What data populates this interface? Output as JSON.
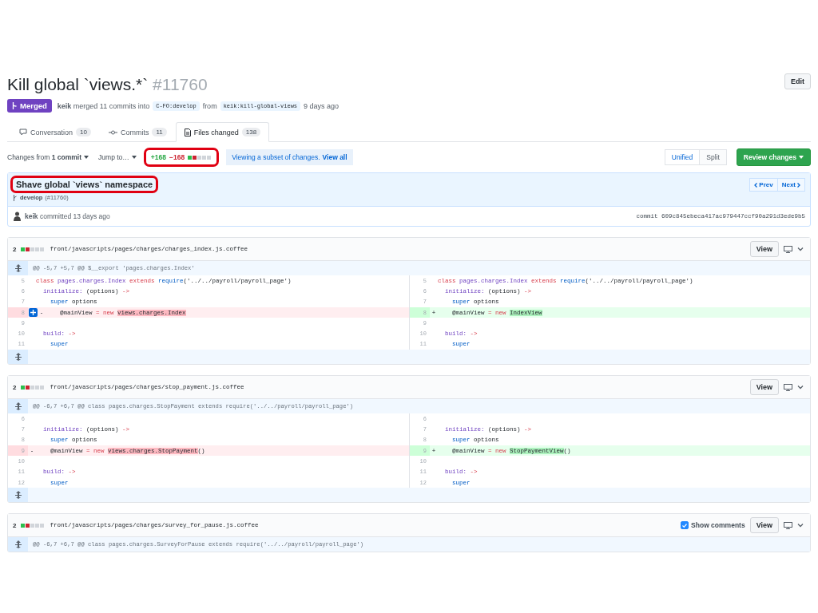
{
  "pull_request": {
    "title": "Kill global `views.*`",
    "number": "#11760",
    "edit_label": "Edit",
    "state": "Merged",
    "merge_text": "**keik** merged 11 commits into",
    "base_branch": "C-FO:develop",
    "from_label": "from",
    "head_branch": "keik:kill-global-views",
    "age": "9 days ago"
  },
  "tabs": [
    {
      "label": "Conversation",
      "count": "10",
      "selected": false
    },
    {
      "label": "Commits",
      "count": "11",
      "selected": false
    },
    {
      "label": "Files changed",
      "count": "138",
      "selected": true
    }
  ],
  "toolbar": {
    "changes_from": "Changes from **1 commit**",
    "jump_to": "Jump to…",
    "additions": "+168",
    "deletions": "−168",
    "stats_annotated": true,
    "notice": "Viewing a subset of changes.",
    "notice_link": "View all",
    "view_modes": [
      {
        "label": "Unified",
        "selected": true
      },
      {
        "label": "Split",
        "selected": false
      }
    ],
    "review_button": "Review changes"
  },
  "commit": {
    "title": "Shave global `views` namespace",
    "title_annotated": true,
    "branch": "develop",
    "pr_ref": "(#11760)",
    "prev": "Prev",
    "next": "Next",
    "byline": "**keik** committed 13 days ago",
    "hash": "commit 609c845ebeca417ac979447ccf90a291d3ede9b5"
  },
  "files": [
    {
      "count": "2",
      "path": "front/javascripts/pages/charges/charges_index.js.coffee",
      "view_label": "View",
      "hunk": "@@ -5,7 +5,7 @@ $__export 'pages.charges.Index'",
      "rows": [
        {
          "left": {
            "num": "5",
            "kind": "context",
            "tokens": [
              {
                "text": "class ",
                "kind": "keyword"
              },
              {
                "text": "pages.charges.Index ",
                "kind": "entity"
              },
              {
                "text": "extends ",
                "kind": "keyword"
              },
              {
                "text": "require",
                "kind": "function"
              },
              {
                "text": "('../../payroll/payroll_page')",
                "kind": "plain"
              }
            ]
          },
          "right": {
            "num": "5",
            "kind": "context",
            "tokens": [
              {
                "text": "class ",
                "kind": "keyword"
              },
              {
                "text": "pages.charges.Index ",
                "kind": "entity"
              },
              {
                "text": "extends ",
                "kind": "keyword"
              },
              {
                "text": "require",
                "kind": "function"
              },
              {
                "text": "('../../payroll/payroll_page')",
                "kind": "plain"
              }
            ]
          }
        },
        {
          "left": {
            "num": "6",
            "kind": "context",
            "tokens": [
              {
                "text": "  initialize:",
                "kind": "entity"
              },
              {
                "text": " (options) ",
                "kind": "plain"
              },
              {
                "text": "->",
                "kind": "keyword"
              }
            ]
          },
          "right": {
            "num": "6",
            "kind": "context",
            "tokens": [
              {
                "text": "  initialize:",
                "kind": "entity"
              },
              {
                "text": " (options) ",
                "kind": "plain"
              },
              {
                "text": "->",
                "kind": "keyword"
              }
            ]
          }
        },
        {
          "left": {
            "num": "7",
            "kind": "context",
            "tokens": [
              {
                "text": "    super",
                "kind": "function"
              },
              {
                "text": " options",
                "kind": "plain"
              }
            ]
          },
          "right": {
            "num": "7",
            "kind": "context",
            "tokens": [
              {
                "text": "    super",
                "kind": "function"
              },
              {
                "text": " options",
                "kind": "plain"
              }
            ]
          }
        },
        {
          "left": {
            "num": "8",
            "kind": "deleted",
            "marker": "-",
            "comment_button": true,
            "tokens": [
              {
                "text": "    @mainView ",
                "kind": "plain"
              },
              {
                "text": "= ",
                "kind": "keyword"
              },
              {
                "text": "new ",
                "kind": "keyword"
              },
              {
                "text": "views.charges.Index",
                "kind": "removed"
              }
            ]
          },
          "right": {
            "num": "8",
            "kind": "added",
            "marker": "+",
            "tokens": [
              {
                "text": "    @mainView ",
                "kind": "plain"
              },
              {
                "text": "= ",
                "kind": "keyword"
              },
              {
                "text": "new ",
                "kind": "keyword"
              },
              {
                "text": "IndexView",
                "kind": "inserted"
              }
            ]
          }
        },
        {
          "left": {
            "num": "9",
            "kind": "context"
          },
          "right": {
            "num": "9",
            "kind": "context"
          }
        },
        {
          "left": {
            "num": "10",
            "kind": "context",
            "tokens": [
              {
                "text": "  build: ",
                "kind": "entity"
              },
              {
                "text": "->",
                "kind": "keyword"
              }
            ]
          },
          "right": {
            "num": "10",
            "kind": "context",
            "tokens": [
              {
                "text": "  build: ",
                "kind": "entity"
              },
              {
                "text": "->",
                "kind": "keyword"
              }
            ]
          }
        },
        {
          "left": {
            "num": "11",
            "kind": "context",
            "tokens": [
              {
                "text": "    super",
                "kind": "function"
              }
            ]
          },
          "right": {
            "num": "11",
            "kind": "context",
            "tokens": [
              {
                "text": "    super",
                "kind": "function"
              }
            ]
          }
        }
      ]
    },
    {
      "count": "2",
      "path": "front/javascripts/pages/charges/stop_payment.js.coffee",
      "view_label": "View",
      "hunk": "@@ -6,7 +6,7 @@ class pages.charges.StopPayment extends require('../../payroll/payroll_page')",
      "rows": [
        {
          "left": {
            "num": "6",
            "kind": "context"
          },
          "right": {
            "num": "6",
            "kind": "context"
          }
        },
        {
          "left": {
            "num": "7",
            "kind": "context",
            "tokens": [
              {
                "text": "  initialize:",
                "kind": "entity"
              },
              {
                "text": " (options) ",
                "kind": "plain"
              },
              {
                "text": "->",
                "kind": "keyword"
              }
            ]
          },
          "right": {
            "num": "7",
            "kind": "context",
            "tokens": [
              {
                "text": "  initialize:",
                "kind": "entity"
              },
              {
                "text": " (options) ",
                "kind": "plain"
              },
              {
                "text": "->",
                "kind": "keyword"
              }
            ]
          }
        },
        {
          "left": {
            "num": "8",
            "kind": "context",
            "tokens": [
              {
                "text": "    super",
                "kind": "function"
              },
              {
                "text": " options",
                "kind": "plain"
              }
            ]
          },
          "right": {
            "num": "8",
            "kind": "context",
            "tokens": [
              {
                "text": "    super",
                "kind": "function"
              },
              {
                "text": " options",
                "kind": "plain"
              }
            ]
          }
        },
        {
          "left": {
            "num": "9",
            "kind": "deleted",
            "marker": "-",
            "tokens": [
              {
                "text": "    @mainView ",
                "kind": "plain"
              },
              {
                "text": "= ",
                "kind": "keyword"
              },
              {
                "text": "new ",
                "kind": "keyword"
              },
              {
                "text": "views.charges.StopPayment",
                "kind": "removed"
              },
              {
                "text": "()",
                "kind": "plain"
              }
            ]
          },
          "right": {
            "num": "9",
            "kind": "added",
            "marker": "+",
            "tokens": [
              {
                "text": "    @mainView ",
                "kind": "plain"
              },
              {
                "text": "= ",
                "kind": "keyword"
              },
              {
                "text": "new ",
                "kind": "keyword"
              },
              {
                "text": "StopPaymentView",
                "kind": "inserted"
              },
              {
                "text": "()",
                "kind": "plain"
              }
            ]
          }
        },
        {
          "left": {
            "num": "10",
            "kind": "context"
          },
          "right": {
            "num": "10",
            "kind": "context"
          }
        },
        {
          "left": {
            "num": "11",
            "kind": "context",
            "tokens": [
              {
                "text": "  build: ",
                "kind": "entity"
              },
              {
                "text": "->",
                "kind": "keyword"
              }
            ]
          },
          "right": {
            "num": "11",
            "kind": "context",
            "tokens": [
              {
                "text": "  build: ",
                "kind": "entity"
              },
              {
                "text": "->",
                "kind": "keyword"
              }
            ]
          }
        },
        {
          "left": {
            "num": "12",
            "kind": "context",
            "tokens": [
              {
                "text": "    super",
                "kind": "function"
              }
            ]
          },
          "right": {
            "num": "12",
            "kind": "context",
            "tokens": [
              {
                "text": "    super",
                "kind": "function"
              }
            ]
          }
        }
      ]
    },
    {
      "count": "2",
      "path": "front/javascripts/pages/charges/survey_for_pause.js.coffee",
      "show_comments": {
        "label": "Show comments",
        "checked": true
      },
      "view_label": "View",
      "hunk": "@@ -6,7 +6,7 @@ class pages.charges.SurveyForPause extends require('../../payroll/payroll_page')"
    }
  ]
}
